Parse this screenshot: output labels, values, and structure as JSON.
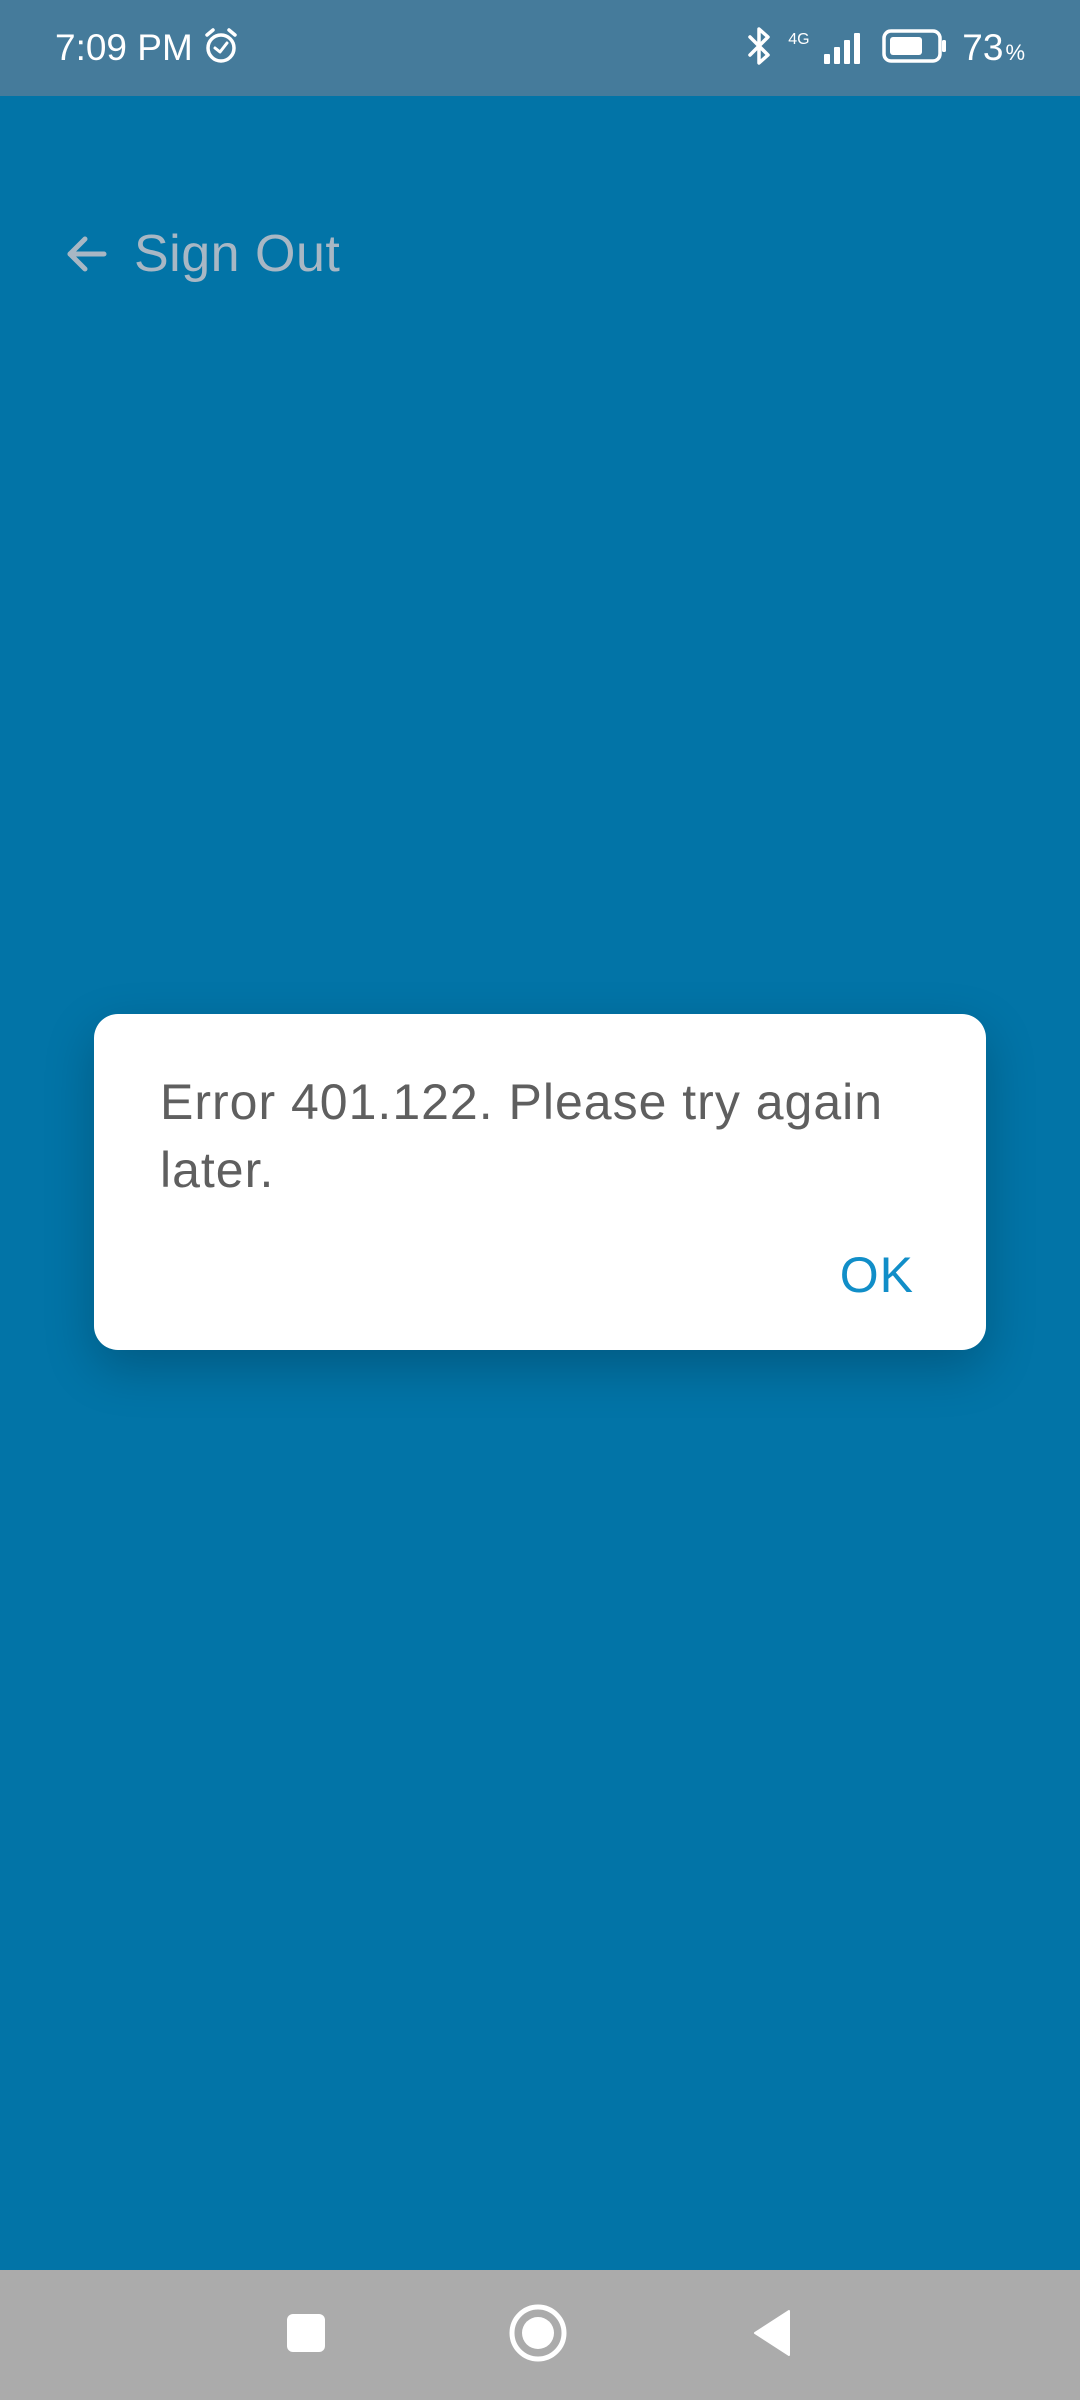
{
  "status_bar": {
    "time": "7:09 PM",
    "network_label": "4G",
    "battery_percent": "73",
    "battery_percent_sign": "%",
    "icons": {
      "alarm": "alarm-clock-icon",
      "bluetooth": "bluetooth-icon",
      "signal": "cell-signal-icon",
      "battery": "battery-icon"
    },
    "battery_level": 0.73
  },
  "app_bar": {
    "back_icon": "arrow-left-icon",
    "title": "Sign Out"
  },
  "dialog": {
    "message": "Error 401.122. Please try again later.",
    "ok_label": "OK"
  },
  "nav_bar": {
    "recents_icon": "square-icon",
    "home_icon": "circle-home-icon",
    "back_icon": "triangle-back-icon"
  },
  "colors": {
    "background": "#0274a7",
    "status_bar": "#457b9b",
    "dialog_ok": "#118ec8",
    "nav_bar": "#ababab"
  }
}
